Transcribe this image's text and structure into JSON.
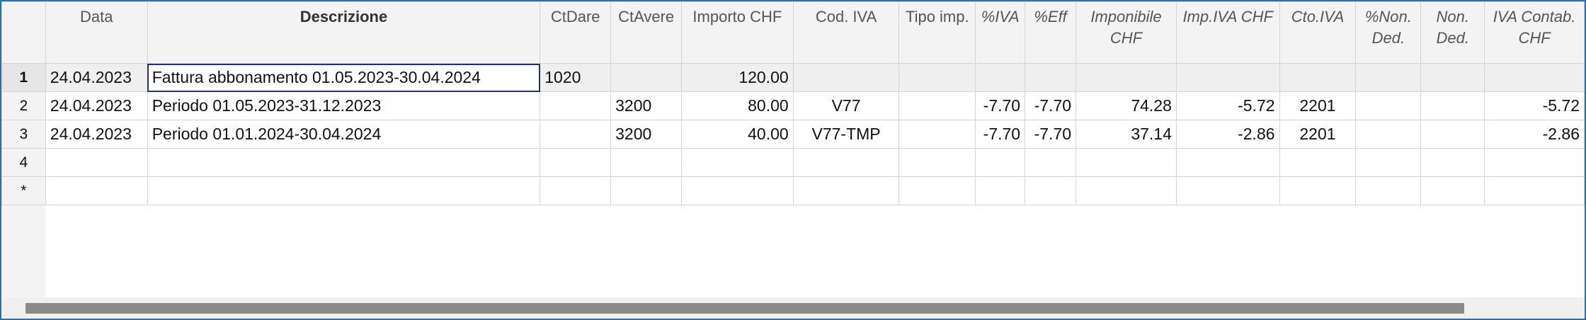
{
  "columns": {
    "data": "Data",
    "descrizione": "Descrizione",
    "ctdare": "CtDare",
    "ctavere": "CtAvere",
    "importo": "Importo CHF",
    "codiva": "Cod. IVA",
    "tipoimp": "Tipo imp.",
    "piva": "%IVA",
    "peff": "%Eff",
    "imponibile": "Imponibile CHF",
    "impiva": "Imp.IVA CHF",
    "ctoiva": "Cto.IVA",
    "pnonded": "%Non. Ded.",
    "nonded": "Non. Ded.",
    "ivacontab": "IVA Contab. CHF"
  },
  "rows": [
    {
      "num": "1",
      "data": "24.04.2023",
      "descrizione": "Fattura abbonamento 01.05.2023-30.04.2024",
      "ctdare": "1020",
      "ctavere": "",
      "importo": "120.00",
      "codiva": "",
      "tipoimp": "",
      "piva": "",
      "peff": "",
      "imponibile": "",
      "impiva": "",
      "ctoiva": "",
      "pnonded": "",
      "nonded": "",
      "ivacontab": ""
    },
    {
      "num": "2",
      "data": "24.04.2023",
      "descrizione": "Periodo 01.05.2023-31.12.2023",
      "ctdare": "",
      "ctavere": "3200",
      "importo": "80.00",
      "codiva": "V77",
      "tipoimp": "",
      "piva": "-7.70",
      "peff": "-7.70",
      "imponibile": "74.28",
      "impiva": "-5.72",
      "ctoiva": "2201",
      "pnonded": "",
      "nonded": "",
      "ivacontab": "-5.72"
    },
    {
      "num": "3",
      "data": "24.04.2023",
      "descrizione": "Periodo 01.01.2024-30.04.2024",
      "ctdare": "",
      "ctavere": "3200",
      "importo": "40.00",
      "codiva": "V77-TMP",
      "tipoimp": "",
      "piva": "-7.70",
      "peff": "-7.70",
      "imponibile": "37.14",
      "impiva": "-2.86",
      "ctoiva": "2201",
      "pnonded": "",
      "nonded": "",
      "ivacontab": "-2.86"
    },
    {
      "num": "4",
      "data": "",
      "descrizione": "",
      "ctdare": "",
      "ctavere": "",
      "importo": "",
      "codiva": "",
      "tipoimp": "",
      "piva": "",
      "peff": "",
      "imponibile": "",
      "impiva": "",
      "ctoiva": "",
      "pnonded": "",
      "nonded": "",
      "ivacontab": ""
    },
    {
      "num": "*",
      "data": "",
      "descrizione": "",
      "ctdare": "",
      "ctavere": "",
      "importo": "",
      "codiva": "",
      "tipoimp": "",
      "piva": "",
      "peff": "",
      "imponibile": "",
      "impiva": "",
      "ctoiva": "",
      "pnonded": "",
      "nonded": "",
      "ivacontab": ""
    }
  ],
  "colors": {
    "negative": "#e02020",
    "selection_border": "#24365e",
    "window_border": "#2f6fa8"
  }
}
